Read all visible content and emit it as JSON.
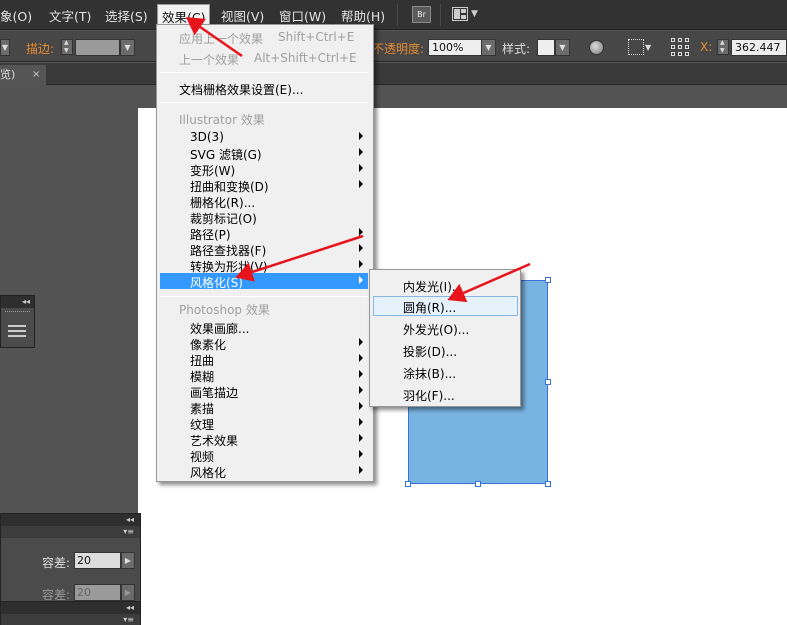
{
  "menubar": {
    "items": [
      {
        "label": "象(O)"
      },
      {
        "label": "文字(T)"
      },
      {
        "label": "选择(S)"
      },
      {
        "label": "效果(C)"
      },
      {
        "label": "视图(V)"
      },
      {
        "label": "窗口(W)"
      },
      {
        "label": "帮助(H)"
      }
    ],
    "bridge_label": "Br"
  },
  "controlbar": {
    "stroke_label": "描边:",
    "opacity_label": "不透明度:",
    "opacity_value": "100%",
    "style_label": "样式:",
    "x_label": "X:",
    "x_value": "362.447"
  },
  "tabbar": {
    "doc_tab": "览)",
    "close": "×"
  },
  "effect_menu": {
    "apply_last": "应用上一个效果",
    "apply_last_shortcut": "Shift+Ctrl+E",
    "last_effect": "上一个效果",
    "last_effect_shortcut": "Alt+Shift+Ctrl+E",
    "raster_settings": "文档栅格效果设置(E)...",
    "illustrator_header": "Illustrator 效果",
    "illustrator_items": [
      {
        "label": "3D(3)",
        "submenu": true
      },
      {
        "label": "SVG 滤镜(G)",
        "submenu": true
      },
      {
        "label": "变形(W)",
        "submenu": true
      },
      {
        "label": "扭曲和变换(D)",
        "submenu": true
      },
      {
        "label": "栅格化(R)...",
        "submenu": false
      },
      {
        "label": "裁剪标记(O)",
        "submenu": false
      },
      {
        "label": "路径(P)",
        "submenu": true
      },
      {
        "label": "路径查找器(F)",
        "submenu": true
      },
      {
        "label": "转换为形状(V)",
        "submenu": true
      },
      {
        "label": "风格化(S)",
        "submenu": true,
        "highlighted": true
      }
    ],
    "photoshop_header": "Photoshop 效果",
    "photoshop_items": [
      {
        "label": "效果画廊...",
        "submenu": false
      },
      {
        "label": "像素化",
        "submenu": true
      },
      {
        "label": "扭曲",
        "submenu": true
      },
      {
        "label": "模糊",
        "submenu": true
      },
      {
        "label": "画笔描边",
        "submenu": true
      },
      {
        "label": "素描",
        "submenu": true
      },
      {
        "label": "纹理",
        "submenu": true
      },
      {
        "label": "艺术效果",
        "submenu": true
      },
      {
        "label": "视频",
        "submenu": true
      },
      {
        "label": "风格化",
        "submenu": true
      }
    ]
  },
  "stylize_submenu": {
    "items": [
      {
        "label": "内发光(I)..."
      },
      {
        "label": "圆角(R)...",
        "hover": true
      },
      {
        "label": "外发光(O)..."
      },
      {
        "label": "投影(D)..."
      },
      {
        "label": "涂抹(B)..."
      },
      {
        "label": "羽化(F)..."
      }
    ]
  },
  "left_panels": {
    "tolerance_label_1": "容差:",
    "tolerance_value_1": "20",
    "tolerance_label_2": "容差:",
    "tolerance_value_2": "20",
    "collapse": "◂◂",
    "menu": "▾≡"
  },
  "colors": {
    "accent_highlight": "#3399ff",
    "orange_label": "#e58a33",
    "shape_fill": "#78b4e2",
    "annotation_arrow": "#e8141b"
  }
}
